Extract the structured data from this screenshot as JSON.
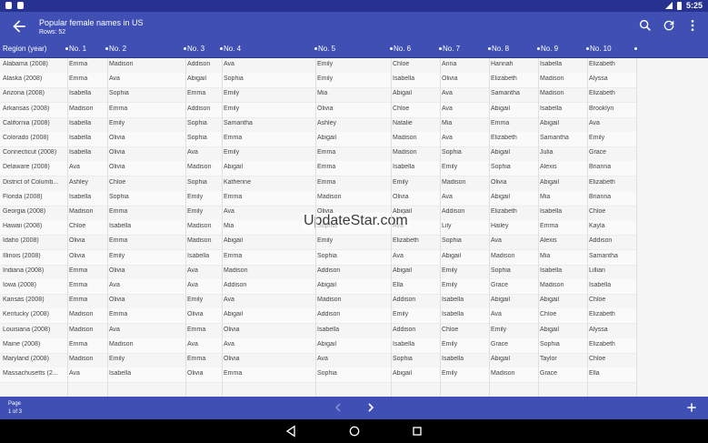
{
  "status_bar": {
    "time": "5:25",
    "icons": [
      "notification-icon",
      "notification-icon",
      "signal-icon",
      "battery-icon"
    ]
  },
  "app_bar": {
    "title": "Popular female names in US",
    "subtitle": "Rows: 52",
    "icons": [
      "back-arrow-icon",
      "search-icon",
      "refresh-icon",
      "more-vert-icon"
    ]
  },
  "table": {
    "columns": [
      "Region (year)",
      "No. 1",
      "No. 2",
      "No. 3",
      "No. 4",
      "No. 5",
      "No. 6",
      "No. 7",
      "No. 8",
      "No. 9",
      "No. 10",
      ""
    ],
    "rows": [
      [
        "Alabama (2008)",
        "Emma",
        "Madison",
        "Addison",
        "Ava",
        "Emily",
        "Chloe",
        "Anna",
        "Hannah",
        "Isabella",
        "Elizabeth"
      ],
      [
        "Alaska (2008)",
        "Emma",
        "Ava",
        "Abigail",
        "Sophia",
        "Emily",
        "Isabella",
        "Olivia",
        "Elizabeth",
        "Madison",
        "Alyssa"
      ],
      [
        "Arizona (2008)",
        "Isabella",
        "Sophia",
        "Emma",
        "Emily",
        "Mia",
        "Abigail",
        "Ava",
        "Samantha",
        "Madison",
        "Elizabeth"
      ],
      [
        "Arkansas (2008)",
        "Madison",
        "Emma",
        "Addison",
        "Emily",
        "Olivia",
        "Chloe",
        "Ava",
        "Abigail",
        "Isabella",
        "Brooklyn"
      ],
      [
        "California (2008)",
        "Isabella",
        "Emily",
        "Sophia",
        "Samantha",
        "Ashley",
        "Natalie",
        "Mia",
        "Emma",
        "Abigail",
        "Ava"
      ],
      [
        "Colorado (2008)",
        "Isabella",
        "Olivia",
        "Sophia",
        "Emma",
        "Abigail",
        "Madison",
        "Ava",
        "Elizabeth",
        "Samantha",
        "Emily"
      ],
      [
        "Connecticut (2008)",
        "Isabella",
        "Olivia",
        "Ava",
        "Emily",
        "Emma",
        "Madison",
        "Sophia",
        "Abigail",
        "Julia",
        "Grace"
      ],
      [
        "Delaware (2008)",
        "Ava",
        "Olivia",
        "Madison",
        "Abigail",
        "Emma",
        "Isabella",
        "Emily",
        "Sophia",
        "Alexis",
        "Brianna"
      ],
      [
        "District of Columb...",
        "Ashley",
        "Chloe",
        "Sophia",
        "Katherine",
        "Emma",
        "Emily",
        "Madison",
        "Olivia",
        "Abigail",
        "Elizabeth"
      ],
      [
        "Florida (2008)",
        "Isabella",
        "Sophia",
        "Emily",
        "Emma",
        "Madison",
        "Olivia",
        "Ava",
        "Abigail",
        "Mia",
        "Brianna"
      ],
      [
        "Georgia (2008)",
        "Madison",
        "Emma",
        "Emily",
        "Ava",
        "Olivia",
        "Abigail",
        "Addison",
        "Elizabeth",
        "Isabella",
        "Chloe"
      ],
      [
        "Hawaii (2008)",
        "Chloe",
        "Isabella",
        "Madison",
        "Mia",
        "Sophia",
        "Ava",
        "Lily",
        "Hailey",
        "Emma",
        "Kayla"
      ],
      [
        "Idaho (2008)",
        "Olivia",
        "Emma",
        "Madison",
        "Abigail",
        "Emily",
        "Elizabeth",
        "Sophia",
        "Ava",
        "Alexis",
        "Addison"
      ],
      [
        "Illinois (2008)",
        "Olivia",
        "Emily",
        "Isabella",
        "Emma",
        "Sophia",
        "Ava",
        "Abigail",
        "Madison",
        "Mia",
        "Samantha"
      ],
      [
        "Indiana (2008)",
        "Emma",
        "Olivia",
        "Ava",
        "Madison",
        "Addison",
        "Abigail",
        "Emily",
        "Sophia",
        "Isabella",
        "Lillian"
      ],
      [
        "Iowa (2008)",
        "Emma",
        "Ava",
        "Ava",
        "Addison",
        "Abigail",
        "Ella",
        "Emily",
        "Grace",
        "Madison",
        "Isabella"
      ],
      [
        "Kansas (2008)",
        "Emma",
        "Olivia",
        "Emily",
        "Ava",
        "Madison",
        "Addison",
        "Isabella",
        "Abigail",
        "Abigail",
        "Chloe"
      ],
      [
        "Kentucky (2008)",
        "Madison",
        "Emma",
        "Olivia",
        "Abigail",
        "Addison",
        "Emily",
        "Isabella",
        "Ava",
        "Chloe",
        "Elizabeth"
      ],
      [
        "Louisiana (2008)",
        "Madison",
        "Ava",
        "Emma",
        "Olivia",
        "Isabella",
        "Addison",
        "Chloe",
        "Emily",
        "Abigail",
        "Alyssa"
      ],
      [
        "Maine (2008)",
        "Emma",
        "Madison",
        "Ava",
        "Ava",
        "Abigail",
        "Isabella",
        "Emily",
        "Grace",
        "Sophia",
        "Elizabeth"
      ],
      [
        "Maryland (2008)",
        "Madison",
        "Emily",
        "Emma",
        "Olivia",
        "Ava",
        "Sophia",
        "Isabella",
        "Abigail",
        "Taylor",
        "Chloe"
      ],
      [
        "Massachusetts (2...",
        "Ava",
        "Isabella",
        "Olivia",
        "Emma",
        "Sophia",
        "Abigail",
        "Emily",
        "Madison",
        "Grace",
        "Ella"
      ]
    ]
  },
  "watermark": "UpdateStar.com",
  "bottom_bar": {
    "page_label": "Page",
    "page_value": "1 of 3",
    "icons": [
      "chevron-left-icon",
      "chevron-right-icon",
      "add-icon"
    ]
  },
  "nav_bar": {
    "icons": [
      "back-triangle-icon",
      "home-circle-icon",
      "recents-square-icon"
    ]
  }
}
